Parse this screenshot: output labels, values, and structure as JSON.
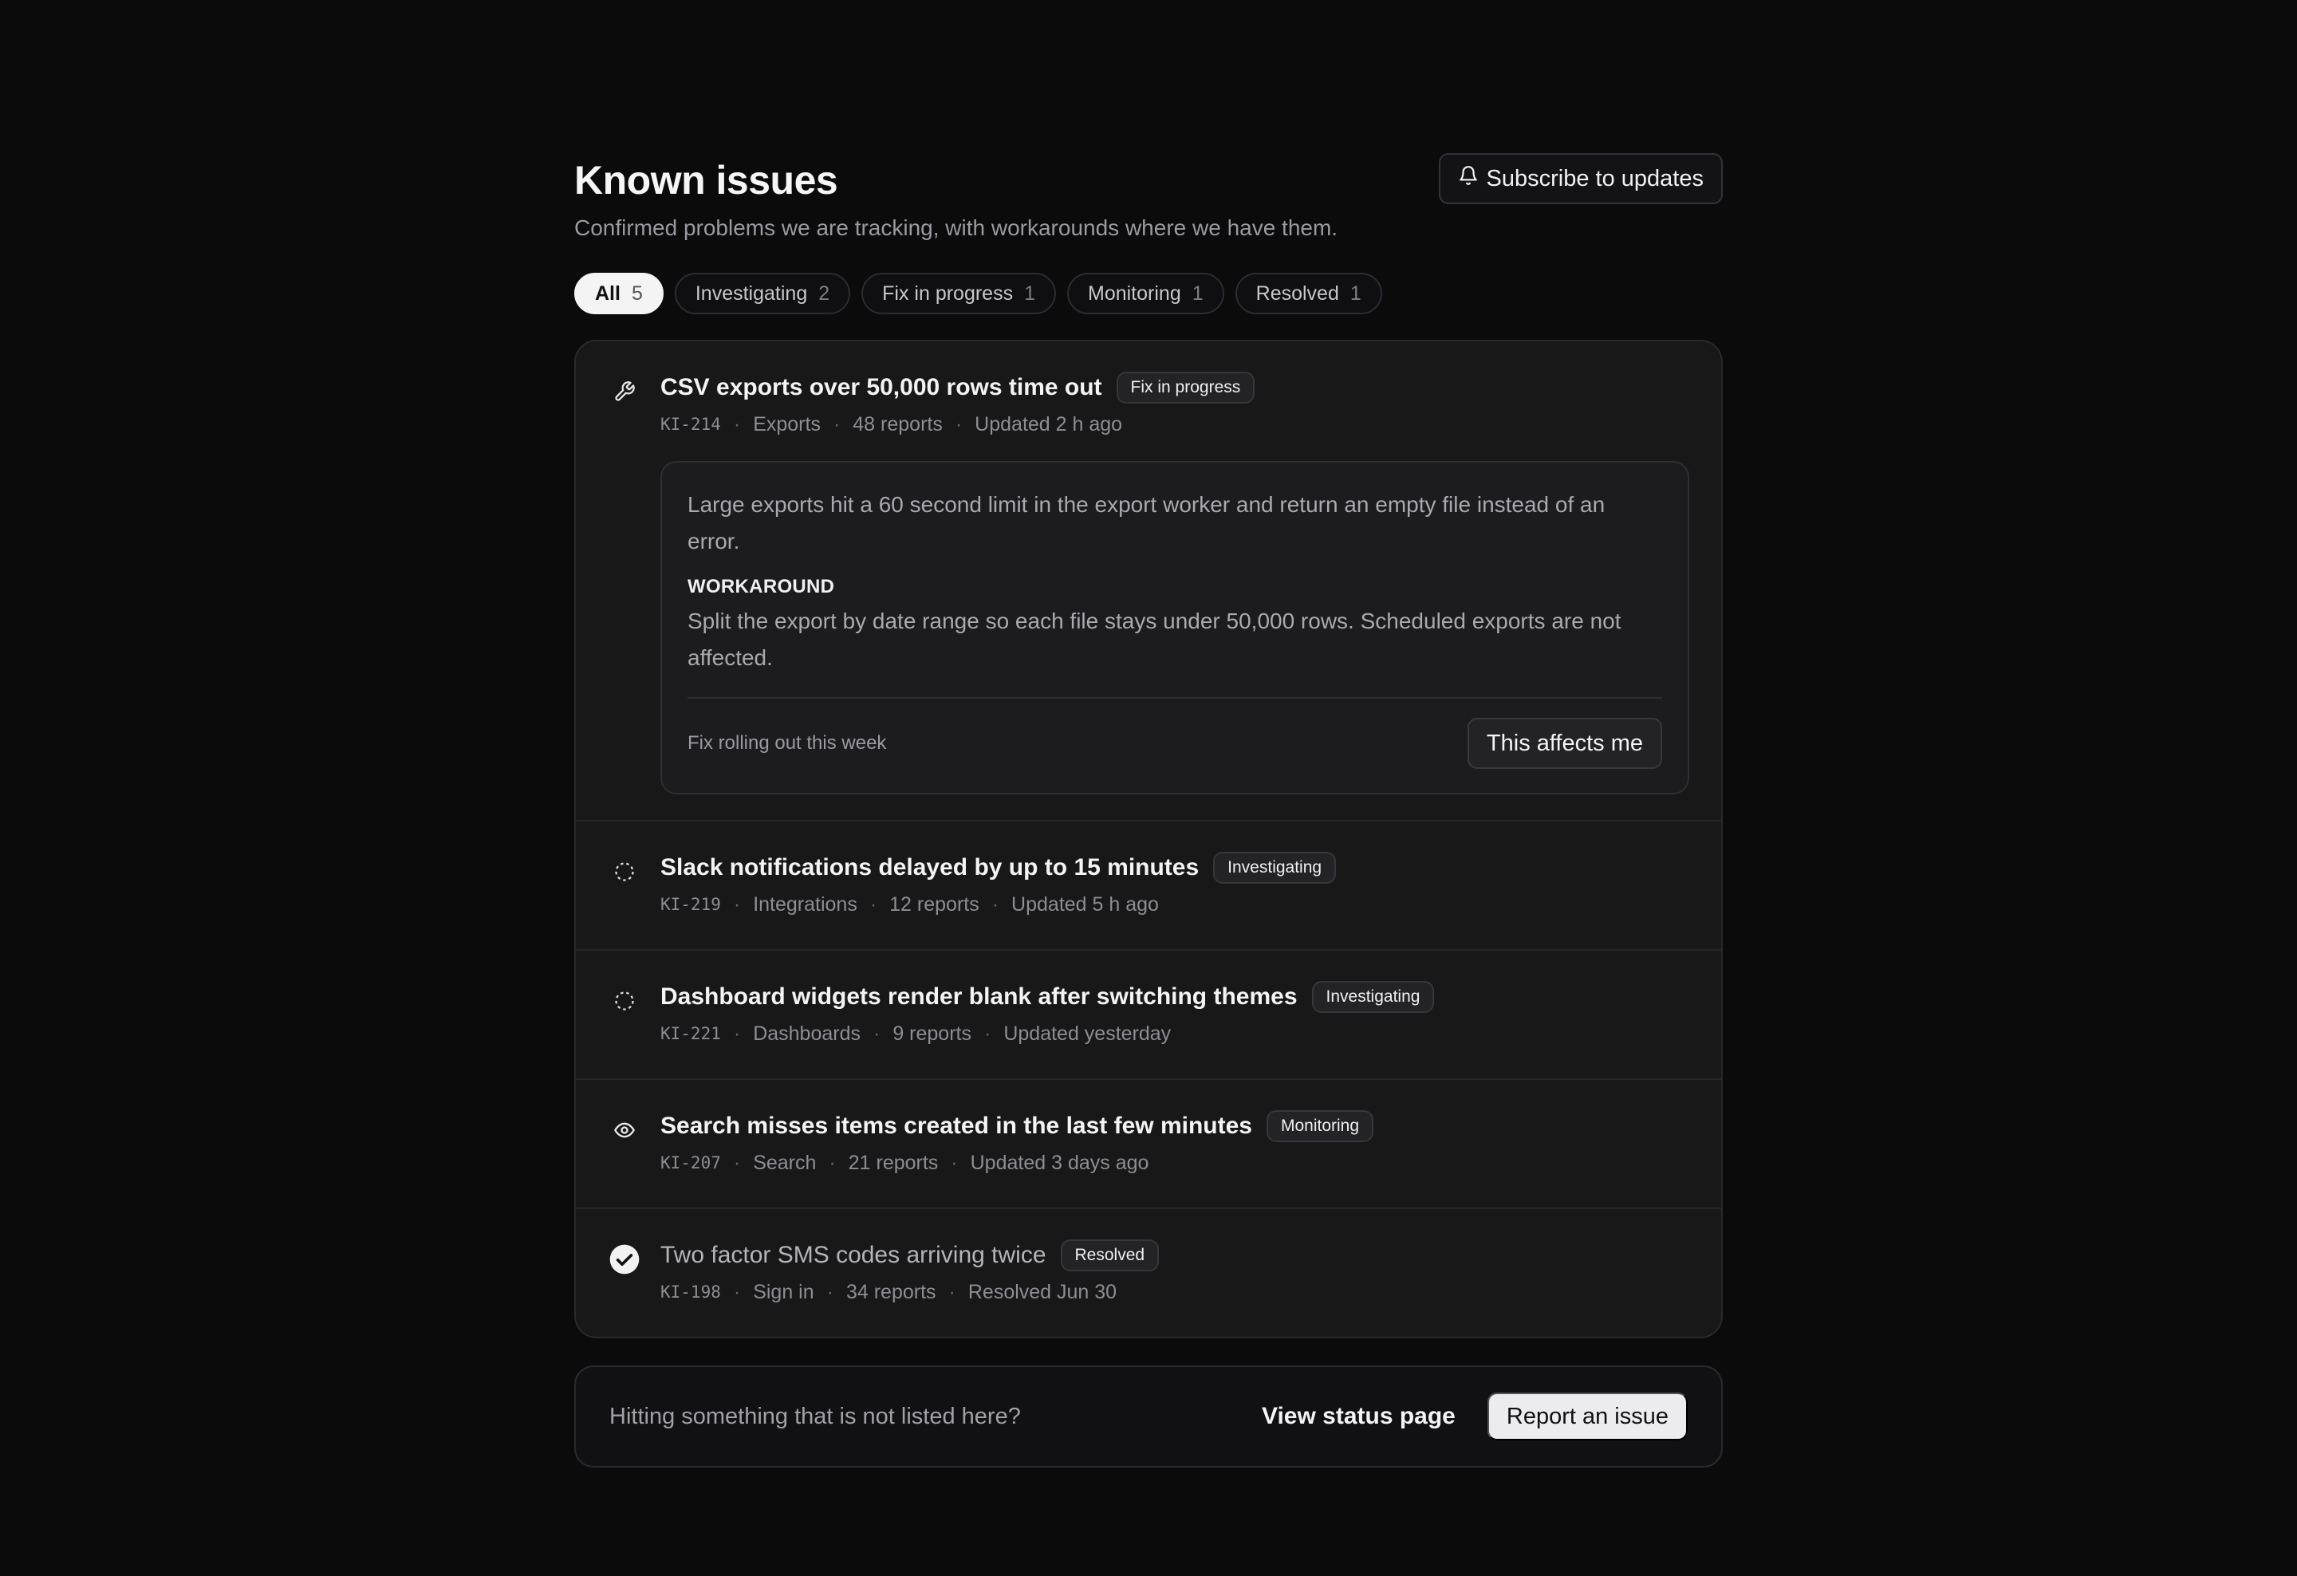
{
  "header": {
    "title": "Known issues",
    "subtitle": "Confirmed problems we are tracking, with workarounds where we have them.",
    "subscribe_label": "Subscribe to updates",
    "subscribe_icon": "bell-icon"
  },
  "filters": [
    {
      "label": "All",
      "count": "5",
      "active": true
    },
    {
      "label": "Investigating",
      "count": "2",
      "active": false
    },
    {
      "label": "Fix in progress",
      "count": "1",
      "active": false
    },
    {
      "label": "Monitoring",
      "count": "1",
      "active": false
    },
    {
      "label": "Resolved",
      "count": "1",
      "active": false
    }
  ],
  "issues": [
    {
      "icon": "wrench-icon",
      "title": "CSV exports over 50,000 rows time out",
      "status": "Fix in progress",
      "id": "KI-214",
      "area": "Exports",
      "reports": "48 reports",
      "updated": "Updated 2 h ago",
      "detail": {
        "description": "Large exports hit a 60 second limit in the export worker and return an empty file instead of an error.",
        "workaround_label": "WORKAROUND",
        "workaround": "Split the export by date range so each file stays under 50,000 rows. Scheduled exports are not affected.",
        "eta": "Fix rolling out this week",
        "affects_label": "This affects me"
      }
    },
    {
      "icon": "dashed-circle-icon",
      "title": "Slack notifications delayed by up to 15 minutes",
      "status": "Investigating",
      "id": "KI-219",
      "area": "Integrations",
      "reports": "12 reports",
      "updated": "Updated 5 h ago"
    },
    {
      "icon": "dashed-circle-icon",
      "title": "Dashboard widgets render blank after switching themes",
      "status": "Investigating",
      "id": "KI-221",
      "area": "Dashboards",
      "reports": "9 reports",
      "updated": "Updated yesterday"
    },
    {
      "icon": "eye-icon",
      "title": "Search misses items created in the last few minutes",
      "status": "Monitoring",
      "id": "KI-207",
      "area": "Search",
      "reports": "21 reports",
      "updated": "Updated 3 days ago"
    },
    {
      "icon": "check-circle-icon",
      "title": "Two factor SMS codes arriving twice",
      "status": "Resolved",
      "id": "KI-198",
      "area": "Sign in",
      "reports": "34 reports",
      "updated": "Resolved Jun 30"
    }
  ],
  "footer": {
    "prompt": "Hitting something that is not listed here?",
    "status_link": "View status page",
    "report_label": "Report an issue"
  }
}
